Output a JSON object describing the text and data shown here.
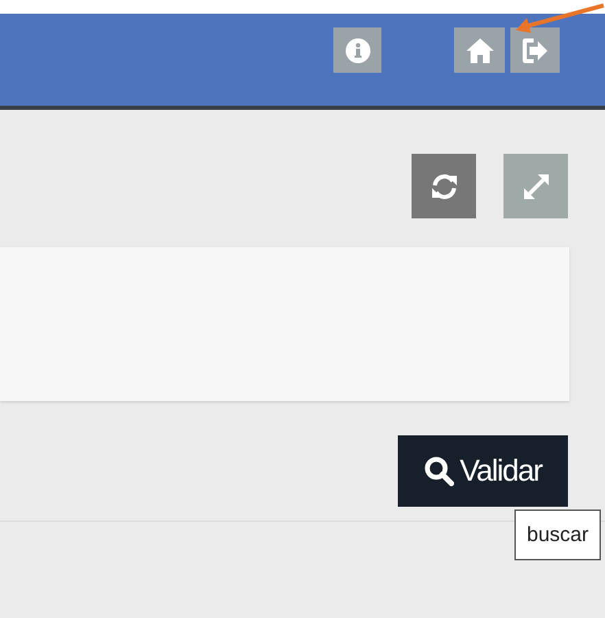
{
  "header": {
    "buttons": [
      {
        "kind": "info"
      },
      {
        "kind": "home"
      },
      {
        "kind": "logout"
      }
    ]
  },
  "annotation": {
    "kind": "arrow"
  },
  "toolbar": {
    "buttons": [
      {
        "kind": "refresh"
      },
      {
        "kind": "expand"
      }
    ]
  },
  "action": {
    "label": "Validar",
    "tooltip": "buscar"
  }
}
